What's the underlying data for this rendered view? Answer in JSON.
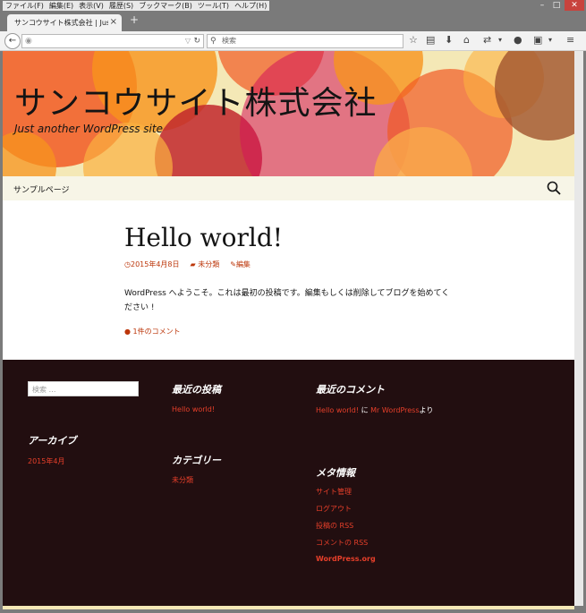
{
  "browser": {
    "menus": [
      "ファイル(F)",
      "編集(E)",
      "表示(V)",
      "履歴(S)",
      "ブックマーク(B)",
      "ツール(T)",
      "ヘルプ(H)"
    ],
    "tab_title": "サンコウサイト株式会社 | Just a...",
    "search_placeholder": "検索"
  },
  "header": {
    "site_title": "サンコウサイト株式会社",
    "site_description": "Just another WordPress site"
  },
  "nav": {
    "sample_page": "サンプルページ"
  },
  "post": {
    "title": "Hello world!",
    "date": "2015年4月8日",
    "category": "未分類",
    "edit": "編集",
    "content": "WordPress へようこそ。これは最初の投稿です。編集もしくは削除してブログを始めてください !",
    "comments": "1件のコメント"
  },
  "footer": {
    "search_placeholder": "検索 …",
    "archives_title": "アーカイブ",
    "archives": [
      "2015年4月"
    ],
    "recent_posts_title": "最近の投稿",
    "recent_posts": [
      "Hello world!"
    ],
    "categories_title": "カテゴリー",
    "categories": [
      "未分類"
    ],
    "recent_comments_title": "最近のコメント",
    "recent_comment": {
      "post": "Hello world!",
      "on": "に",
      "author": "Mr WordPress",
      "suffix": "より"
    },
    "meta_title": "メタ情報",
    "meta_links": [
      "サイト管理",
      "ログアウト",
      "投稿の RSS",
      "コメントの RSS",
      "WordPress.org"
    ]
  }
}
